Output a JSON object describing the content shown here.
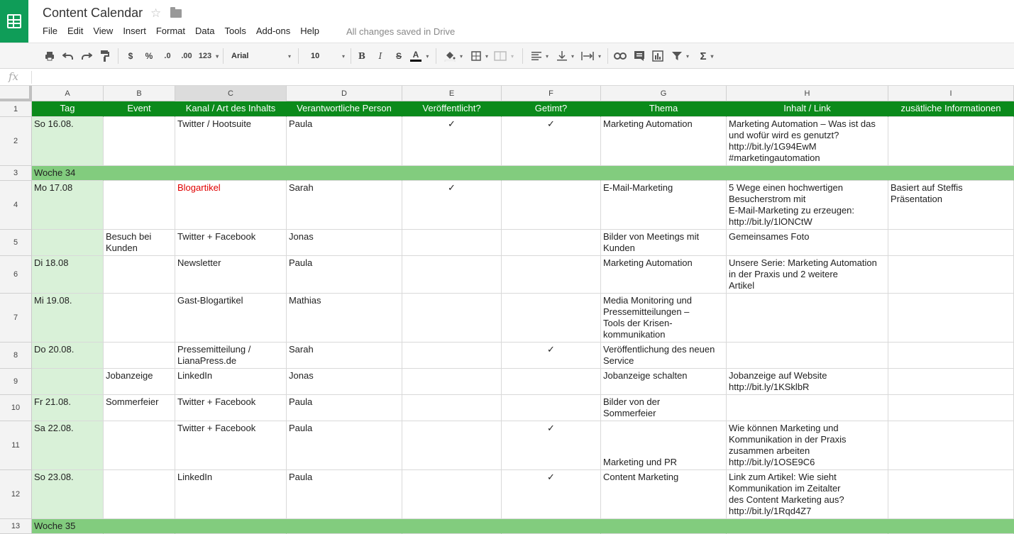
{
  "app": {
    "title": "Content Calendar",
    "save_status": "All changes saved in Drive",
    "menu": [
      "File",
      "Edit",
      "View",
      "Insert",
      "Format",
      "Data",
      "Tools",
      "Add-ons",
      "Help"
    ],
    "brand_color": "#0f9d58"
  },
  "toolbar": {
    "currency": "$",
    "percent": "%",
    "decrease_decimal": ".0",
    "increase_decimal": ".00",
    "number_format": "123",
    "font": "Arial",
    "font_size": "10",
    "bold": "B",
    "italic": "I",
    "strike": "S",
    "text_color": "A",
    "sum": "Σ",
    "icons": [
      "print-icon",
      "undo-icon",
      "redo-icon",
      "paint-format-icon",
      "fill-color-icon",
      "borders-icon",
      "merge-icon",
      "align-icon",
      "valign-icon",
      "wrap-icon",
      "link-icon",
      "comment-icon",
      "chart-icon",
      "filter-icon"
    ]
  },
  "formula_bar": {
    "label": "fx",
    "value": ""
  },
  "sheet": {
    "columns": [
      "A",
      "B",
      "C",
      "D",
      "E",
      "F",
      "G",
      "H",
      "I"
    ],
    "header": [
      "Tag",
      "Event",
      "Kanal / Art des Inhalts",
      "Verantwortliche Person",
      "Veröffentlicht?",
      "Getimt?",
      "Thema",
      "Inhalt / Link",
      "zusätliche Informationen"
    ],
    "rows": [
      {
        "num": "2",
        "type": "data",
        "cells": [
          "So 16.08.",
          "",
          "Twitter / Hootsuite",
          "Paula",
          "✓",
          "✓",
          "Marketing Automation",
          "Marketing Automation – Was ist das\nund wofür wird es genutzt?\nhttp://bit.ly/1G94EwM\n#marketingautomation",
          ""
        ]
      },
      {
        "num": "3",
        "type": "week",
        "cells": [
          "Woche 34",
          "",
          "",
          "",
          "",
          "",
          "",
          "",
          ""
        ]
      },
      {
        "num": "4",
        "type": "data",
        "cells": [
          "Mo 17.08",
          "",
          "Blogartikel",
          "Sarah",
          "✓",
          "",
          "E-Mail-Marketing",
          "5 Wege einen hochwertigen\nBesucherstrom mit\nE-Mail-Marketing zu erzeugen:\nhttp://bit.ly/1lONCtW",
          "Basiert auf Steffis\nPräsentation"
        ]
      },
      {
        "num": "5",
        "type": "data",
        "cells": [
          "",
          "Besuch bei\nKunden",
          "Twitter + Facebook",
          "Jonas",
          "",
          "",
          "Bilder von Meetings mit\nKunden",
          "Gemeinsames Foto",
          ""
        ]
      },
      {
        "num": "6",
        "type": "data",
        "cells": [
          "Di 18.08",
          "",
          "Newsletter",
          "Paula",
          "",
          "",
          "Marketing Automation",
          "Unsere Serie: Marketing Automation\nin der Praxis und 2 weitere\nArtikel",
          ""
        ]
      },
      {
        "num": "7",
        "type": "data",
        "cells": [
          "Mi 19.08.",
          "",
          "Gast-Blogartikel",
          "Mathias",
          "",
          "",
          "Media Monitoring und\nPressemitteilungen –\nTools der Krisen-\nkommunikation",
          "",
          ""
        ]
      },
      {
        "num": "8",
        "type": "data",
        "cells": [
          "Do 20.08.",
          "",
          "Pressemitteilung /\nLianaPress.de",
          "Sarah",
          "",
          "✓",
          "Veröffentlichung des neuen\nService",
          "",
          ""
        ]
      },
      {
        "num": "9",
        "type": "data",
        "cells": [
          "",
          "Jobanzeige",
          "LinkedIn",
          "Jonas",
          "",
          "",
          "Jobanzeige schalten",
          "Jobanzeige auf Website\nhttp://bit.ly/1KSklbR",
          ""
        ]
      },
      {
        "num": "10",
        "type": "data",
        "cells": [
          "Fr 21.08.",
          "Sommerfeier",
          "Twitter + Facebook",
          "Paula",
          "",
          "",
          "Bilder von der\nSommerfeier",
          "",
          ""
        ]
      },
      {
        "num": "11",
        "type": "data",
        "cells": [
          "Sa 22.08.",
          "",
          "Twitter + Facebook",
          "Paula",
          "",
          "✓",
          "Marketing und PR",
          "Wie können Marketing und\nKommunikation in der Praxis\nzusammen arbeiten\nhttp://bit.ly/1OSE9C6",
          ""
        ]
      },
      {
        "num": "12",
        "type": "data",
        "cells": [
          "So 23.08.",
          "",
          "LinkedIn",
          "Paula",
          "",
          "✓",
          "Content Marketing",
          "Link zum Artikel: Wie sieht\nKommunikation im Zeitalter\ndes Content Marketing aus?\nhttp://bit.ly/1Rqd4Z7",
          ""
        ]
      },
      {
        "num": "13",
        "type": "week",
        "cells": [
          "Woche 35",
          "",
          "",
          "",
          "",
          "",
          "",
          "",
          ""
        ]
      }
    ],
    "colors": {
      "header_bg": "#0b8a1b",
      "week_bg": "#82cc7e",
      "date_bg": "#d9f1d8",
      "highlight_text": "#e00000"
    }
  }
}
